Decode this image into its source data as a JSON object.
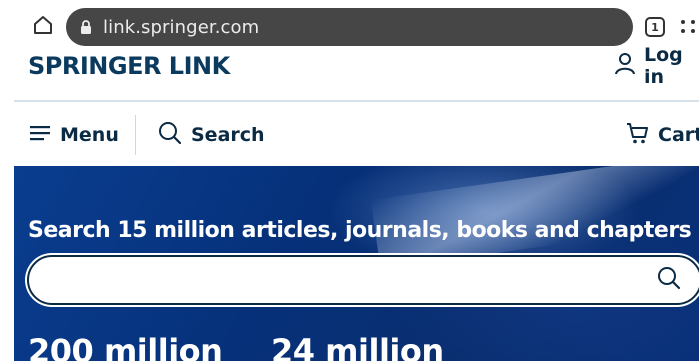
{
  "browser": {
    "url": "link.springer.com",
    "tab_count": "1"
  },
  "header": {
    "logo_text": "SPRINGER LINK",
    "login_label": "Log in"
  },
  "nav": {
    "menu_label": "Menu",
    "search_label": "Search",
    "cart_label": "Cart"
  },
  "hero": {
    "heading": "Search 15 million articles, journals, books and chapters",
    "search_value": "",
    "stats": [
      "200 million",
      "24 million"
    ]
  },
  "colors": {
    "brand_navy": "#0b2a43",
    "hero_blue": "#06317a",
    "url_bar": "#454645"
  },
  "icons": [
    "home-icon",
    "lock-icon",
    "tabs-icon",
    "overflow-icon",
    "user-icon",
    "hamburger-icon",
    "search-icon",
    "cart-icon"
  ]
}
